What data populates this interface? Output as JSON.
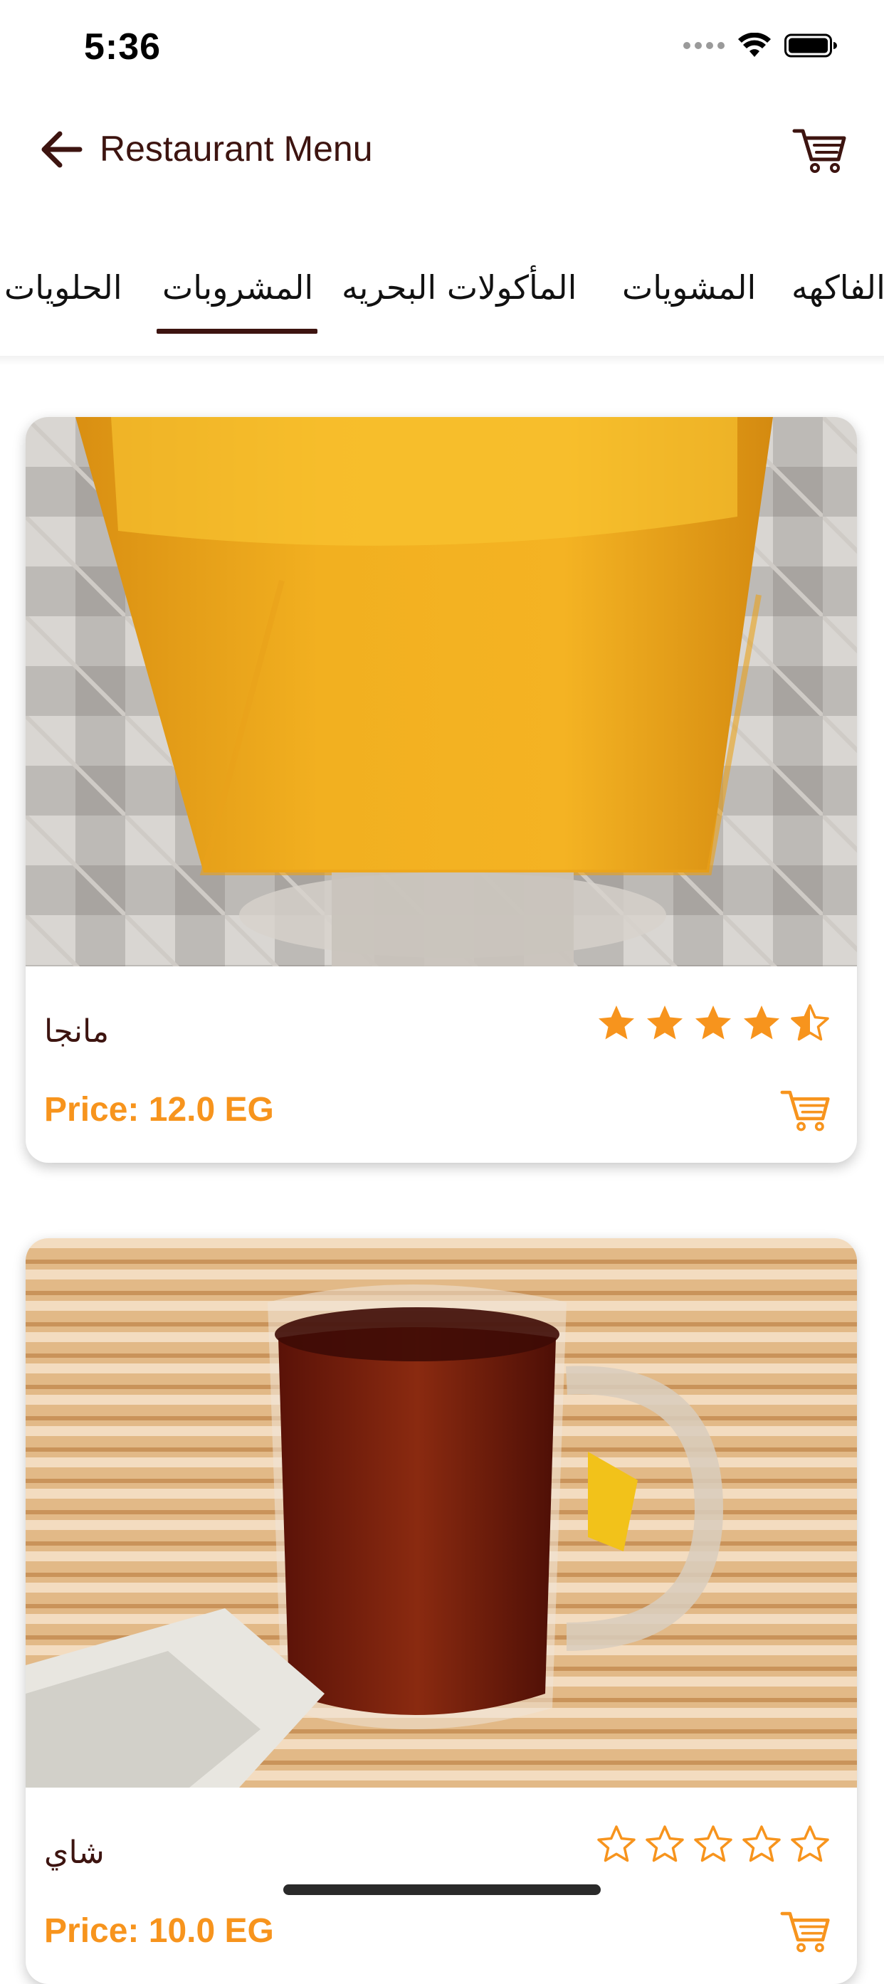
{
  "status_bar": {
    "time": "5:36"
  },
  "nav": {
    "title": "Restaurant Menu",
    "back_icon": "arrow-left-icon",
    "cart_icon": "shopping-cart-icon"
  },
  "tabs": [
    {
      "label": "الحلويات",
      "selected": false
    },
    {
      "label": "المشروبات",
      "selected": true
    },
    {
      "label": "المأكولات البحريه",
      "selected": false
    },
    {
      "label": "المشويات",
      "selected": false
    },
    {
      "label": "الفاكهه",
      "selected": false
    }
  ],
  "products": [
    {
      "name": "مانجا",
      "price_label": "Price: 12.0 EG",
      "rating": 4.5,
      "max_rating": 5
    },
    {
      "name": "شاي",
      "price_label": "Price: 10.0 EG",
      "rating": 0,
      "max_rating": 5
    }
  ],
  "colors": {
    "brand_dark": "#3d1410",
    "accent_orange": "#f7941d"
  }
}
